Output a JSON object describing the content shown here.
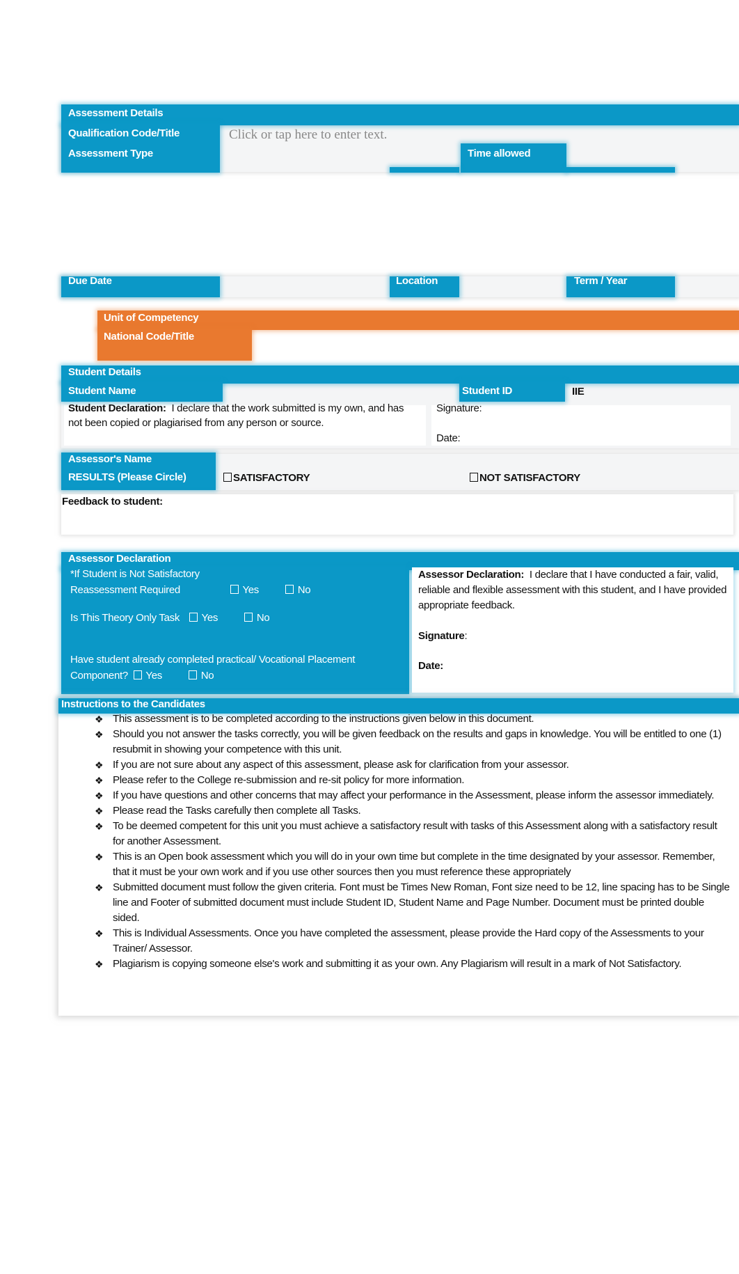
{
  "assessment_details": {
    "header": "Assessment Details",
    "qualification_label": "Qualification Code/Title",
    "qualification_placeholder": "Click or tap here to enter text.",
    "assessment_type_label": "Assessment Type",
    "time_allowed_label": "Time allowed",
    "due_date_label": "Due Date",
    "location_label": "Location",
    "term_year_label": "Term / Year"
  },
  "unit": {
    "unit_label": "Unit of Competency",
    "national_code_label": "National Code/Title"
  },
  "student": {
    "header": "Student Details",
    "name_label": "Student Name",
    "id_label": "Student ID",
    "id_value": "IIE",
    "declaration_bold": "Student Declaration:",
    "declaration_text": "I declare that the work submitted is my own, and has not been copied or plagiarised from any person or source.",
    "signature_label": "Signature:",
    "date_label": "Date:"
  },
  "results": {
    "assessor_name_label": "Assessor's Name",
    "results_label": "RESULTS (Please Circle)",
    "satisfactory": "SATISFACTORY",
    "not_satisfactory": "NOT SATISFACTORY",
    "feedback_label": "Feedback to student:"
  },
  "assessor_declaration": {
    "header": "Assessor Declaration",
    "not_satisfactory_note": "*If Student is Not Satisfactory",
    "reassessment_label": "Reassessment Required",
    "theory_label": "Is This Theory Only Task",
    "practical_label_1": "Have student already completed practical/ Vocational Placement",
    "practical_label_2": "Component?",
    "yes": "Yes",
    "no": "No",
    "declaration_bold": "Assessor Declaration:",
    "declaration_text": "I declare that I have conducted a fair, valid, reliable and flexible assessment with this student, and I have provided appropriate feedback.",
    "signature_label": "Signature",
    "signature_colon": ":",
    "date_label": "Date:"
  },
  "instructions": {
    "header": "Instructions to the Candidates",
    "bullet_icon": "diamond-bullet-icon",
    "items": [
      "This assessment is to be completed according to the instructions given below in this document.",
      "Should you not answer the tasks correctly, you will be given feedback on the results and gaps in knowledge. You will be entitled to one (1) resubmit in showing your competence with this unit.",
      "If you are not sure about any aspect of this assessment, please ask for clarification from your assessor.",
      "Please refer to the College re-submission and re-sit policy for more information.",
      "If you have questions and other concerns that may affect your performance in the Assessment, please inform the assessor immediately.",
      "Please read the Tasks carefully then complete all Tasks.",
      "To be deemed competent for this unit you must achieve a satisfactory result with tasks of this Assessment along with a satisfactory result for another Assessment.",
      "This is an Open book assessment which you will do in your own time but complete in the time designated by your assessor. Remember, that it must be your own work and if you use other sources then you must reference these appropriately",
      "Submitted document must follow the given criteria. Font must be Times New Roman, Font size need to be 12, line spacing has to be Single line and Footer of submitted document must include Student ID, Student Name and Page Number. Document must be printed double sided.",
      "This is Individual Assessments. Once you have completed the assessment, please provide the Hard copy of the Assessments to your Trainer/ Assessor.",
      "Plagiarism is copying someone else's work and submitting it as your own. Any Plagiarism will result in a mark of Not Satisfactory."
    ]
  },
  "colors": {
    "header_blue": "#0b98c7",
    "unit_orange": "#e9792f"
  }
}
